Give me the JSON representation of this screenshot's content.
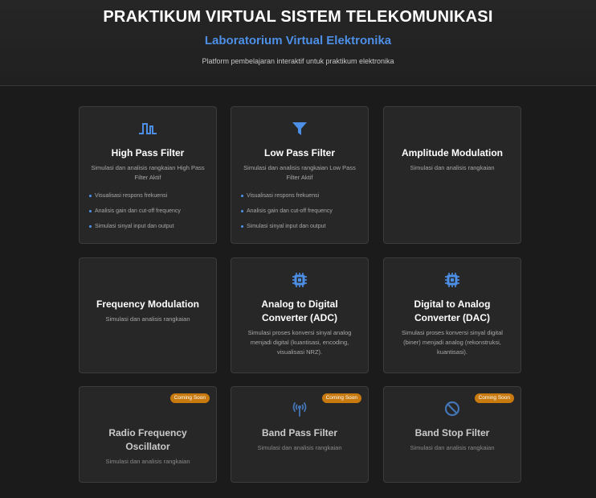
{
  "header": {
    "title": "PRAKTIKUM VIRTUAL SISTEM TELEKOMUNIKASI",
    "subtitle": "Laboratorium Virtual Elektronika",
    "description": "Platform pembelajaran interaktif untuk praktikum elektronika"
  },
  "colors": {
    "accent": "#4d8fe6",
    "badge": "#c87a0e",
    "background": "#1b1b1b",
    "card": "#272727"
  },
  "cards": [
    {
      "title": "High Pass Filter",
      "description": "Simulasi dan analisis rangkaian High Pass Filter Aktif",
      "icon": "square-wave-icon",
      "features": [
        "Visualisasi respons frekuensi",
        "Analisis gain dan cut-off frequency",
        "Simulasi sinyal input dan output"
      ]
    },
    {
      "title": "Low Pass Filter",
      "description": "Simulasi dan analisis rangkaian Low Pass Filter Aktif",
      "icon": "filter-funnel-icon",
      "features": [
        "Visualisasi respons frekuensi",
        "Analisis gain dan cut-off frequency",
        "Simulasi sinyal input dan output"
      ]
    },
    {
      "title": "Amplitude Modulation",
      "description": "Simulasi dan analisis rangkaian"
    },
    {
      "title": "Frequency Modulation",
      "description": "Simulasi dan analisis rangkaian"
    },
    {
      "title": "Analog to Digital Converter (ADC)",
      "description": "Simulasi proses konversi sinyal analog menjadi digital (kuantisasi, encoding, visualisasi NRZ).",
      "icon": "microchip-icon"
    },
    {
      "title": "Digital to Analog Converter (DAC)",
      "description": "Simulasi proses konversi sinyal digital (biner) menjadi analog (rekonstruksi, kuantisasi).",
      "icon": "microchip-icon"
    },
    {
      "title": "Radio Frequency Oscillator",
      "description": "Simulasi dan analisis rangkaian",
      "badge": "Coming Soon"
    },
    {
      "title": "Band Pass Filter",
      "description": "Simulasi dan analisis rangkaian",
      "icon": "broadcast-tower-icon",
      "badge": "Coming Soon"
    },
    {
      "title": "Band Stop Filter",
      "description": "Simulasi dan analisis rangkaian",
      "icon": "ban-icon",
      "badge": "Coming Soon"
    }
  ]
}
